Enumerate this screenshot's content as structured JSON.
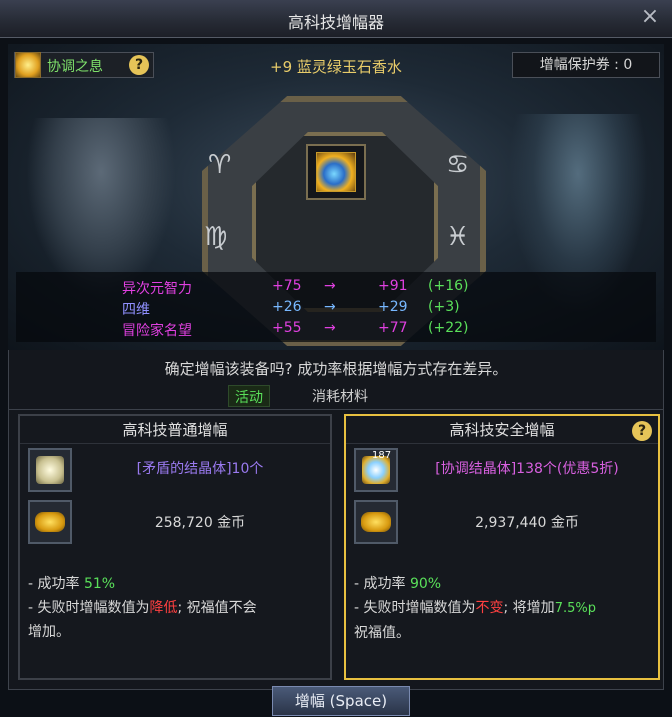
{
  "window": {
    "title": "高科技增幅器",
    "close_icon": "close-icon"
  },
  "header": {
    "set_label": "协调之息",
    "item_name": "+9 蓝灵绿玉石香水",
    "protect_label": "增幅保护券 :",
    "protect_value": "0"
  },
  "runes": [
    "♈",
    "♋",
    "♍",
    "♓"
  ],
  "stats": [
    {
      "name": "异次元智力",
      "from": "+75",
      "arrow": "→",
      "to": "+91",
      "diff": "(+16)",
      "color": "#e040e0"
    },
    {
      "name": "四维",
      "from": "+26",
      "arrow": "→",
      "to": "+29",
      "diff": "(+3)",
      "color": "#78b8ff"
    },
    {
      "name": "冒险家名望",
      "from": "+55",
      "arrow": "→",
      "to": "+77",
      "diff": "(+22)",
      "color": "#e040e0"
    }
  ],
  "confirm_text": "确定增幅该装备吗? 成功率根据增幅方式存在差异。",
  "tabs": {
    "active": "活动",
    "inactive": "消耗材料"
  },
  "panels": {
    "normal": {
      "title": "高科技普通增幅",
      "material": "[矛盾的结晶体]10个",
      "gold": "258,720 金币",
      "rate_prefix": "- 成功率 ",
      "rate_value": "51%",
      "fail_prefix": "- 失败时增幅数值为",
      "fail_value": "降低",
      "fail_suffix": "; 祝福值不会",
      "fail_line2": "增加。"
    },
    "safe": {
      "title": "高科技安全增幅",
      "badge": "187",
      "material": "[协调结晶体]138个(优惠5折)",
      "gold": "2,937,440 金币",
      "rate_prefix": "- 成功率 ",
      "rate_value": "90%",
      "fail_prefix": "- 失败时增幅数值为",
      "fail_value": "不变",
      "fail_suffix": "; 将增加",
      "bless_value": "7.5%p",
      "fail_line2": "祝福值。"
    }
  },
  "button": {
    "label": "增幅 (Space)"
  },
  "colors": {
    "accent_gold": "#e8c040",
    "green": "#5ae05a",
    "red": "#ff4040",
    "magenta": "#e040e0"
  }
}
